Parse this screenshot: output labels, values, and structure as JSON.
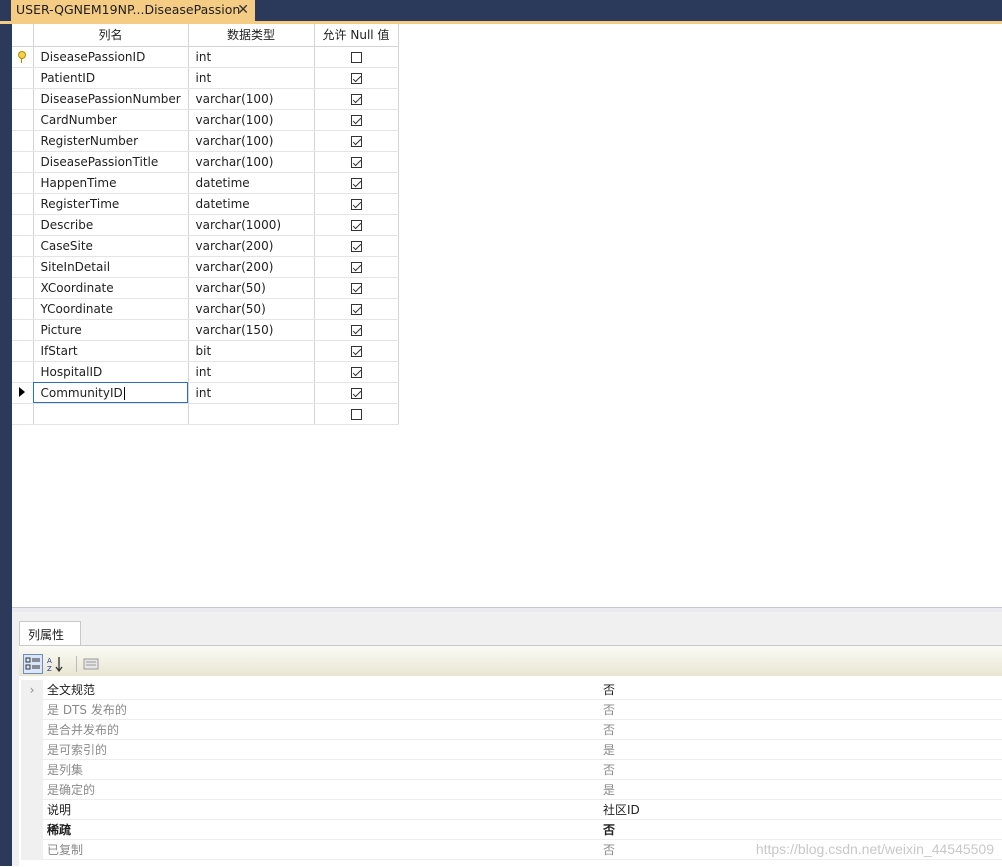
{
  "document_tab": {
    "title": "USER-QGNEM19NP...DiseasePassion",
    "close_glyph": "✕"
  },
  "designer": {
    "headers": {
      "name": "列名",
      "type": "数据类型",
      "null": "允许 Null 值"
    },
    "rows": [
      {
        "name": "DiseasePassionID",
        "type": "int",
        "allow_null": false,
        "primary_key": true
      },
      {
        "name": "PatientID",
        "type": "int",
        "allow_null": true
      },
      {
        "name": "DiseasePassionNumber",
        "type": "varchar(100)",
        "allow_null": true
      },
      {
        "name": "CardNumber",
        "type": "varchar(100)",
        "allow_null": true
      },
      {
        "name": "RegisterNumber",
        "type": "varchar(100)",
        "allow_null": true
      },
      {
        "name": "DiseasePassionTitle",
        "type": "varchar(100)",
        "allow_null": true
      },
      {
        "name": "HappenTime",
        "type": "datetime",
        "allow_null": true
      },
      {
        "name": "RegisterTime",
        "type": "datetime",
        "allow_null": true
      },
      {
        "name": "Describe",
        "type": "varchar(1000)",
        "allow_null": true
      },
      {
        "name": "CaseSite",
        "type": "varchar(200)",
        "allow_null": true
      },
      {
        "name": "SiteInDetail",
        "type": "varchar(200)",
        "allow_null": true
      },
      {
        "name": "XCoordinate",
        "type": "varchar(50)",
        "allow_null": true
      },
      {
        "name": "YCoordinate",
        "type": "varchar(50)",
        "allow_null": true
      },
      {
        "name": "Picture",
        "type": "varchar(150)",
        "allow_null": true
      },
      {
        "name": "IfStart",
        "type": "bit",
        "allow_null": true
      },
      {
        "name": "HospitalID",
        "type": "int",
        "allow_null": true
      },
      {
        "name": "CommunityID",
        "type": "int",
        "allow_null": true,
        "current": true
      },
      {
        "name": "",
        "type": "",
        "allow_null": false,
        "new_row": true
      }
    ]
  },
  "properties": {
    "tab_label": "列属性",
    "toolbar": {
      "categorized_icon": "categorized-icon",
      "alphabetical_icon": "sort-az-icon",
      "property_pages_icon": "property-pages-icon"
    },
    "expand_glyph": "›",
    "items": [
      {
        "name": "全文规范",
        "value": "否",
        "style": "normal",
        "expandable": true
      },
      {
        "name": "是 DTS 发布的",
        "value": "否",
        "style": "muted"
      },
      {
        "name": "是合并发布的",
        "value": "否",
        "style": "muted"
      },
      {
        "name": "是可索引的",
        "value": "是",
        "style": "muted"
      },
      {
        "name": "是列集",
        "value": "否",
        "style": "muted"
      },
      {
        "name": "是确定的",
        "value": "是",
        "style": "muted"
      },
      {
        "name": "说明",
        "value": "社区ID",
        "style": "normal"
      },
      {
        "name": "稀疏",
        "value": "否",
        "style": "bold"
      },
      {
        "name": "已复制",
        "value": "否",
        "style": "muted"
      }
    ]
  },
  "watermark": "https://blog.csdn.net/weixin_44545509"
}
